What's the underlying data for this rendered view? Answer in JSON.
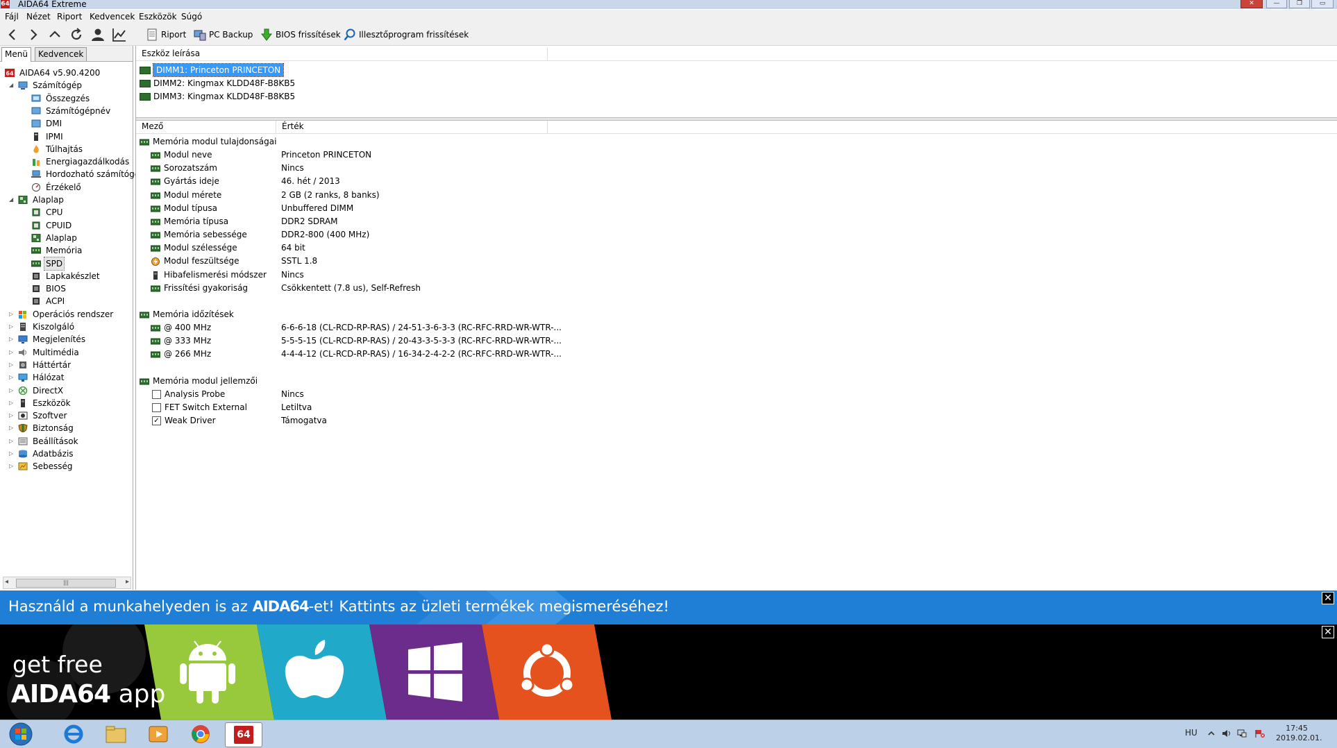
{
  "window": {
    "title": "AIDA64 Extreme",
    "app_icon_text": "64",
    "controls": [
      "✕",
      "—",
      "❐",
      "▭"
    ]
  },
  "menubar": [
    "Fájl",
    "Nézet",
    "Riport",
    "Kedvencek",
    "Eszközök",
    "Súgó"
  ],
  "toolbar": {
    "buttons": [
      "Riport",
      "PC Backup",
      "BIOS frissítések",
      "Illesztőprogram frissítések"
    ]
  },
  "left_tabs": [
    "Menü",
    "Kedvencek"
  ],
  "tree": [
    {
      "label": "AIDA64 v5.90.4200",
      "icon": "aida-icon"
    },
    {
      "label": "Számítógép",
      "icon": "computer-icon",
      "expanded": true
    },
    {
      "label": "Összegzés",
      "icon": "summary-icon"
    },
    {
      "label": "Számítógépnév",
      "icon": "computer-name-icon"
    },
    {
      "label": "DMI",
      "icon": "dmi-icon"
    },
    {
      "label": "IPMI",
      "icon": "ipmi-icon"
    },
    {
      "label": "Túlhajtás",
      "icon": "overclock-icon"
    },
    {
      "label": "Energiagazdálkodás",
      "icon": "power-icon"
    },
    {
      "label": "Hordozható számítógé",
      "icon": "laptop-icon"
    },
    {
      "label": "Érzékelő",
      "icon": "sensor-icon"
    },
    {
      "label": "Alaplap",
      "icon": "motherboard-icon",
      "expanded": true
    },
    {
      "label": "CPU",
      "icon": "cpu-icon"
    },
    {
      "label": "CPUID",
      "icon": "cpuid-icon"
    },
    {
      "label": "Alaplap",
      "icon": "motherboard-icon"
    },
    {
      "label": "Memória",
      "icon": "memory-icon"
    },
    {
      "label": "SPD",
      "icon": "spd-icon",
      "selected": true
    },
    {
      "label": "Lapkakészlet",
      "icon": "chipset-icon"
    },
    {
      "label": "BIOS",
      "icon": "bios-icon"
    },
    {
      "label": "ACPI",
      "icon": "acpi-icon"
    },
    {
      "label": "Operációs rendszer",
      "icon": "windows-icon",
      "expanded": false
    },
    {
      "label": "Kiszolgáló",
      "icon": "server-icon",
      "expanded": false
    },
    {
      "label": "Megjelenítés",
      "icon": "display-icon",
      "expanded": false
    },
    {
      "label": "Multimédia",
      "icon": "multimedia-icon",
      "expanded": false
    },
    {
      "label": "Háttértár",
      "icon": "storage-icon",
      "expanded": false
    },
    {
      "label": "Hálózat",
      "icon": "network-icon",
      "expanded": false
    },
    {
      "label": "DirectX",
      "icon": "directx-icon",
      "expanded": false
    },
    {
      "label": "Eszközök",
      "icon": "devices-icon",
      "expanded": false
    },
    {
      "label": "Szoftver",
      "icon": "software-icon",
      "expanded": false
    },
    {
      "label": "Biztonság",
      "icon": "security-icon",
      "expanded": false
    },
    {
      "label": "Beállítások",
      "icon": "settings-icon",
      "expanded": false
    },
    {
      "label": "Adatbázis",
      "icon": "database-icon",
      "expanded": false
    },
    {
      "label": "Sebesség",
      "icon": "benchmark-icon",
      "expanded": false
    }
  ],
  "device_list": {
    "header": "Eszköz leírása",
    "items": [
      {
        "label": "DIMM1: Princeton PRINCETON",
        "selected": true
      },
      {
        "label": "DIMM2: Kingmax KLDD48F-B8KB5"
      },
      {
        "label": "DIMM3: Kingmax KLDD48F-B8KB5"
      }
    ]
  },
  "details": {
    "col_field": "Mező",
    "col_value": "Érték",
    "rows": [
      {
        "kind": "group",
        "label": "Memória modul tulajdonságai",
        "icon": "memory-icon"
      },
      {
        "kind": "item",
        "label": "Modul neve",
        "value": "Princeton PRINCETON",
        "icon": "memory-icon"
      },
      {
        "kind": "item",
        "label": "Sorozatszám",
        "value": "Nincs",
        "icon": "memory-icon"
      },
      {
        "kind": "item",
        "label": "Gyártás ideje",
        "value": "46. hét / 2013",
        "icon": "memory-icon"
      },
      {
        "kind": "item",
        "label": "Modul mérete",
        "value": "2 GB (2 ranks, 8 banks)",
        "icon": "memory-icon"
      },
      {
        "kind": "item",
        "label": "Modul típusa",
        "value": "Unbuffered DIMM",
        "icon": "memory-icon"
      },
      {
        "kind": "item",
        "label": "Memória típusa",
        "value": "DDR2 SDRAM",
        "icon": "memory-icon"
      },
      {
        "kind": "item",
        "label": "Memória sebessége",
        "value": "DDR2-800 (400 MHz)",
        "icon": "memory-icon"
      },
      {
        "kind": "item",
        "label": "Modul szélessége",
        "value": "64 bit",
        "icon": "memory-icon"
      },
      {
        "kind": "item",
        "label": "Modul feszültsége",
        "value": "SSTL 1.8",
        "icon": "voltage-icon"
      },
      {
        "kind": "item",
        "label": "Hibafelismerési módszer",
        "value": "Nincs",
        "icon": "ecc-icon"
      },
      {
        "kind": "item",
        "label": "Frissítési gyakoriság",
        "value": "Csökkentett (7.8 us), Self-Refresh",
        "icon": "memory-icon"
      },
      {
        "kind": "blank"
      },
      {
        "kind": "group",
        "label": "Memória időzítések",
        "icon": "memory-icon"
      },
      {
        "kind": "item",
        "label": "@ 400 MHz",
        "value": "6-6-6-18  (CL-RCD-RP-RAS) / 24-51-3-6-3-3  (RC-RFC-RRD-WR-WTR-...",
        "icon": "memory-icon"
      },
      {
        "kind": "item",
        "label": "@ 333 MHz",
        "value": "5-5-5-15  (CL-RCD-RP-RAS) / 20-43-3-5-3-3  (RC-RFC-RRD-WR-WTR-...",
        "icon": "memory-icon"
      },
      {
        "kind": "item",
        "label": "@ 266 MHz",
        "value": "4-4-4-12  (CL-RCD-RP-RAS) / 16-34-2-4-2-2  (RC-RFC-RRD-WR-WTR-...",
        "icon": "memory-icon"
      },
      {
        "kind": "blank"
      },
      {
        "kind": "group",
        "label": "Memória modul jellemzői",
        "icon": "memory-icon"
      },
      {
        "kind": "check",
        "label": "Analysis Probe",
        "value": "Nincs",
        "checked": false
      },
      {
        "kind": "check",
        "label": "FET Switch External",
        "value": "Letiltva",
        "checked": false
      },
      {
        "kind": "check",
        "label": "Weak Driver",
        "value": "Támogatva",
        "checked": true
      }
    ]
  },
  "ad": {
    "banner_prefix": "Használd a munkahelyeden is az ",
    "banner_brand": "AIDA64",
    "banner_suffix": "-et! Kattints az üzleti termékek megismeréséhez!",
    "close_glyph": "✕",
    "app_line1": "get free",
    "app_brand": "AIDA64",
    "app_word": "app",
    "platforms": [
      "android-icon",
      "apple-icon",
      "windows-icon",
      "ubuntu-icon"
    ],
    "colors": {
      "blue": "#1f7fd6",
      "android": "#98c93c",
      "apple": "#21a9c9",
      "windows": "#6b2c8c",
      "ubuntu": "#e5521e"
    }
  },
  "taskbar": {
    "apps": [
      "start-orb-icon",
      "internet-explorer-icon",
      "file-explorer-icon",
      "media-player-icon",
      "chrome-icon",
      "aida64-icon"
    ],
    "aida_text": "64",
    "lang": "HU",
    "time": "17:45",
    "date": "2019.02.01."
  }
}
